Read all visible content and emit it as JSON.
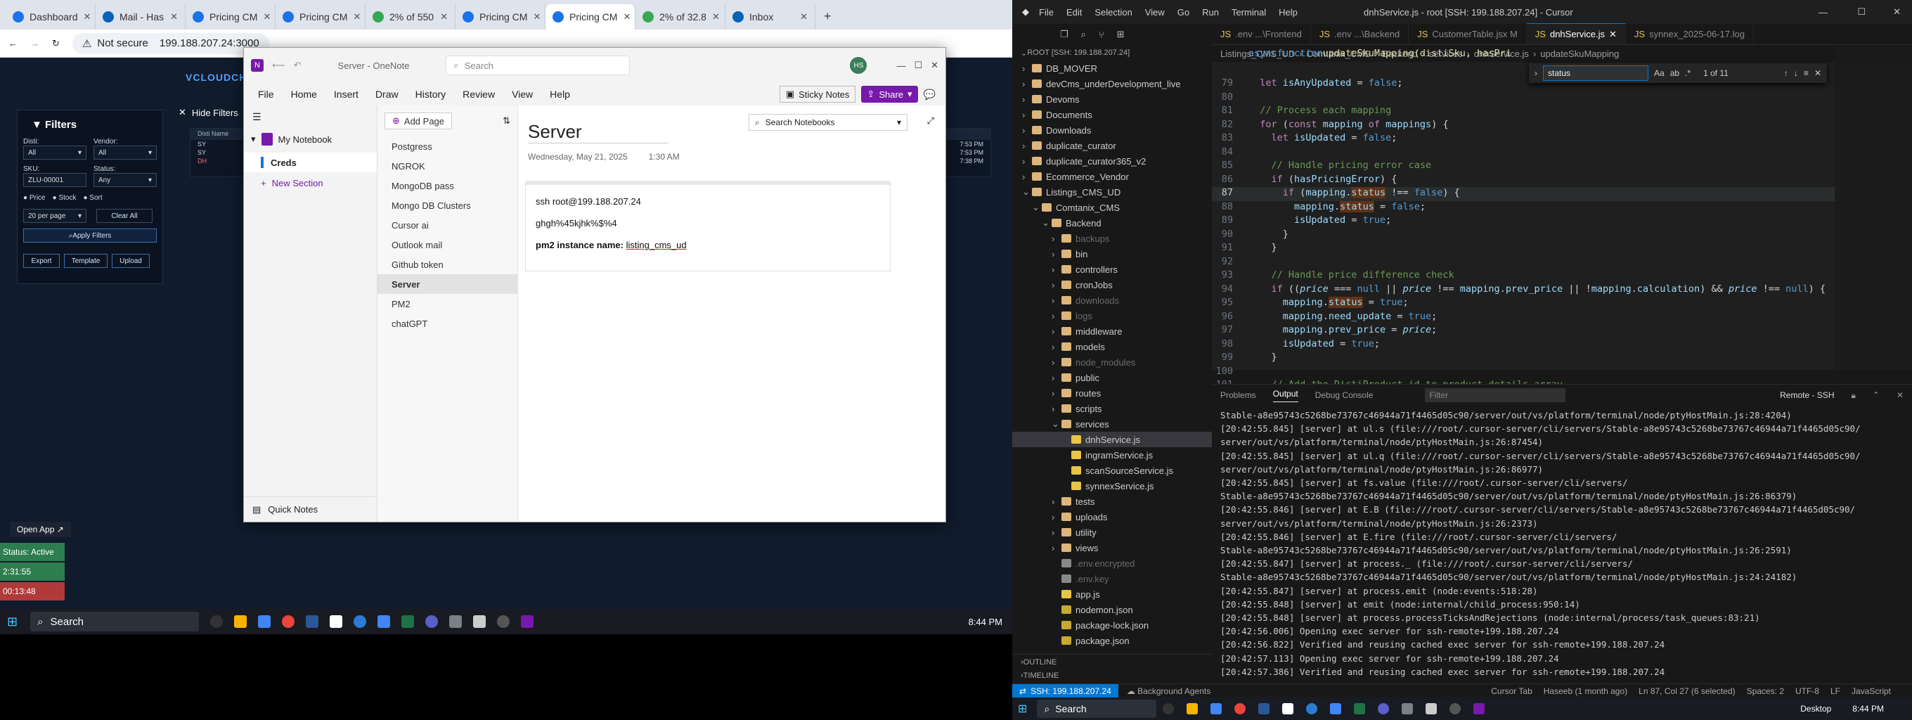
{
  "browser": {
    "tabs": [
      {
        "title": "Dashboard",
        "color": "#1a73e8"
      },
      {
        "title": "Mail - Has",
        "color": "#0364b8"
      },
      {
        "title": "Pricing CM",
        "color": "#1a73e8"
      },
      {
        "title": "Pricing CM",
        "color": "#1a73e8"
      },
      {
        "title": "2% of 550",
        "color": "#34a853"
      },
      {
        "title": "Pricing CM",
        "color": "#1a73e8"
      },
      {
        "title": "Pricing CM",
        "color": "#1a73e8"
      },
      {
        "title": "2% of 32.8",
        "color": "#34a853"
      },
      {
        "title": "Inbox",
        "color": "#0364b8"
      }
    ],
    "security": "Not secure",
    "url": "199.188.207.24:3000"
  },
  "webapp": {
    "brand": "VCLOUDCH",
    "filters_title": "Filters",
    "hide_filters": "Hide Filters",
    "disti_label": "Disti:",
    "disti_value": "All",
    "vendor_label": "Vendor:",
    "vendor_value": "All",
    "sku_label": "SKU:",
    "sku_value": "ZLU-00001",
    "status_label": "Status:",
    "status_value": "Any",
    "radio": [
      "Price",
      "Stock",
      "Sort"
    ],
    "per_page": "20 per page",
    "clear_all": "Clear All",
    "apply": "Apply Filters",
    "export": "Export",
    "template": "Template",
    "upload": "Upload",
    "table_header": "Disti Name",
    "rows": [
      "SY",
      "SY",
      "DH"
    ],
    "times": [
      "7:53 PM",
      "7:53 PM",
      "7:38 PM"
    ],
    "open_app": "Open App ↗",
    "status_active": "Status: Active",
    "time1": "2:31:55",
    "time2": "00:13:48"
  },
  "taskbar_left": {
    "search": "Search",
    "clock": "8:44 PM"
  },
  "onenote": {
    "title": "Server  -  OneNote",
    "search_placeholder": "Search",
    "avatar": "HS",
    "sticky": "Sticky Notes",
    "share": "Share",
    "menu": [
      "File",
      "Home",
      "Insert",
      "Draw",
      "History",
      "Review",
      "View",
      "Help"
    ],
    "notebook": "My Notebook",
    "section": "Creds",
    "new_section": "New Section",
    "quick_notes": "Quick Notes",
    "add_page": "Add Page",
    "search_notebooks": "Search Notebooks",
    "pages": [
      "Postgress",
      "NGROK",
      "MongoDB pass",
      "Mongo DB Clusters",
      "Cursor ai",
      "Outlook mail",
      "Github token",
      "Server",
      "PM2",
      "chatGPT"
    ],
    "selected_page": "Server",
    "page_title": "Server",
    "page_date": "Wednesday, May 21, 2025",
    "page_time": "1:30 AM",
    "note_line1": "ssh root@199.188.207.24",
    "note_line2": "ghgh%45kjhk%$%4",
    "note_label": "pm2 instance name:",
    "note_value": "listing_cms_ud"
  },
  "cursor": {
    "title": "dnhService.js - root [SSH: 199.188.207.24] - Cursor",
    "menu": [
      "File",
      "Edit",
      "Selection",
      "View",
      "Go",
      "Run",
      "Terminal",
      "Help"
    ],
    "explorer_root": "ROOT [SSH: 199.188.207.24]",
    "tree": [
      {
        "name": "DB_MOVER",
        "depth": 0,
        "type": "folder",
        "open": false
      },
      {
        "name": "devCms_underDevelopment_live",
        "depth": 0,
        "type": "folder",
        "open": false
      },
      {
        "name": "Devoms",
        "depth": 0,
        "type": "folder",
        "open": false
      },
      {
        "name": "Documents",
        "depth": 0,
        "type": "folder",
        "open": false
      },
      {
        "name": "Downloads",
        "depth": 0,
        "type": "folder",
        "open": false
      },
      {
        "name": "duplicate_curator",
        "depth": 0,
        "type": "folder",
        "open": false
      },
      {
        "name": "duplicate_curator365_v2",
        "depth": 0,
        "type": "folder",
        "open": false
      },
      {
        "name": "Ecommerce_Vendor",
        "depth": 0,
        "type": "folder",
        "open": false
      },
      {
        "name": "Listings_CMS_UD",
        "depth": 0,
        "type": "folder",
        "open": true
      },
      {
        "name": "Comtanix_CMS",
        "depth": 1,
        "type": "folder",
        "open": true
      },
      {
        "name": "Backend",
        "depth": 2,
        "type": "folder",
        "open": true
      },
      {
        "name": "backups",
        "depth": 3,
        "type": "folder",
        "open": false,
        "dim": true
      },
      {
        "name": "bin",
        "depth": 3,
        "type": "folder",
        "open": false
      },
      {
        "name": "controllers",
        "depth": 3,
        "type": "folder",
        "open": false
      },
      {
        "name": "cronJobs",
        "depth": 3,
        "type": "folder",
        "open": false
      },
      {
        "name": "downloads",
        "depth": 3,
        "type": "folder",
        "open": false,
        "dim": true
      },
      {
        "name": "logs",
        "depth": 3,
        "type": "folder",
        "open": false,
        "dim": true
      },
      {
        "name": "middleware",
        "depth": 3,
        "type": "folder",
        "open": false
      },
      {
        "name": "models",
        "depth": 3,
        "type": "folder",
        "open": false
      },
      {
        "name": "node_modules",
        "depth": 3,
        "type": "folder",
        "open": false,
        "dim": true
      },
      {
        "name": "public",
        "depth": 3,
        "type": "folder",
        "open": false
      },
      {
        "name": "routes",
        "depth": 3,
        "type": "folder",
        "open": false
      },
      {
        "name": "scripts",
        "depth": 3,
        "type": "folder",
        "open": false
      },
      {
        "name": "services",
        "depth": 3,
        "type": "folder",
        "open": true
      },
      {
        "name": "dnhService.js",
        "depth": 4,
        "type": "js",
        "sel": true
      },
      {
        "name": "ingramService.js",
        "depth": 4,
        "type": "js"
      },
      {
        "name": "scanSourceService.js",
        "depth": 4,
        "type": "js"
      },
      {
        "name": "synnexService.js",
        "depth": 4,
        "type": "js"
      },
      {
        "name": "tests",
        "depth": 3,
        "type": "folder",
        "open": false
      },
      {
        "name": "uploads",
        "depth": 3,
        "type": "folder",
        "open": false
      },
      {
        "name": "utility",
        "depth": 3,
        "type": "folder",
        "open": false
      },
      {
        "name": "views",
        "depth": 3,
        "type": "folder",
        "open": false
      },
      {
        "name": ".env.encrypted",
        "depth": 3,
        "type": "file",
        "dim": true
      },
      {
        "name": ".env.key",
        "depth": 3,
        "type": "file",
        "dim": true
      },
      {
        "name": "app.js",
        "depth": 3,
        "type": "js"
      },
      {
        "name": "nodemon.json",
        "depth": 3,
        "type": "json"
      },
      {
        "name": "package-lock.json",
        "depth": 3,
        "type": "json"
      },
      {
        "name": "package.json",
        "depth": 3,
        "type": "json"
      }
    ],
    "outline": "OUTLINE",
    "timeline": "TIMELINE",
    "tabs": [
      {
        "name": ".env ...\\Frontend",
        "active": false
      },
      {
        "name": ".env ...\\Backend",
        "active": false
      },
      {
        "name": "CustomerTable.jsx M",
        "active": false
      },
      {
        "name": "dnhService.js",
        "active": true
      },
      {
        "name": "synnex_2025-06-17.log",
        "active": false
      }
    ],
    "breadcrumb": [
      "Listings_CMS_UD",
      "Comtanix_CMS",
      "Backend",
      "services",
      "dnhService.js",
      "updateSkuMapping"
    ],
    "find_value": "status",
    "find_count": "1 of 11",
    "code_first_line": "async function updateSkuMapping(distiSku, hasPri",
    "code_lines": [
      {
        "n": "79",
        "t": "  let isAnyUpdated = false;"
      },
      {
        "n": "80",
        "t": ""
      },
      {
        "n": "81",
        "t": "  // Process each mapping"
      },
      {
        "n": "82",
        "t": "  for (const mapping of mappings) {"
      },
      {
        "n": "83",
        "t": "    let isUpdated = false;"
      },
      {
        "n": "84",
        "t": ""
      },
      {
        "n": "85",
        "t": "    // Handle pricing error case"
      },
      {
        "n": "86",
        "t": "    if (hasPricingError) {"
      },
      {
        "n": "87",
        "t": "      if (mapping.status !== false) {"
      },
      {
        "n": "88",
        "t": "        mapping.status = false;"
      },
      {
        "n": "89",
        "t": "        isUpdated = true;"
      },
      {
        "n": "90",
        "t": "      }"
      },
      {
        "n": "91",
        "t": "    }"
      },
      {
        "n": "92",
        "t": ""
      },
      {
        "n": "93",
        "t": "    // Handle price difference check"
      },
      {
        "n": "94",
        "t": "    if ((price === null || price !== mapping.prev_price || !mapping.calculation) && price !== null) {"
      },
      {
        "n": "95",
        "t": "      mapping.status = true;"
      },
      {
        "n": "96",
        "t": "      mapping.need_update = true;"
      },
      {
        "n": "97",
        "t": "      mapping.prev_price = price;"
      },
      {
        "n": "98",
        "t": "      isUpdated = true;"
      },
      {
        "n": "99",
        "t": "    }"
      },
      {
        "n": "100",
        "t": ""
      },
      {
        "n": "101",
        "t": "    // Add the DistiProduct id to product details array"
      }
    ],
    "panel_tabs": [
      "Problems",
      "Output",
      "Debug Console"
    ],
    "panel_filter": "Filter",
    "panel_source": "Remote - SSH",
    "output": [
      "Stable-a8e95743c5268be73767c46944a71f4465d05c90/server/out/vs/platform/terminal/node/ptyHostMain.js:28:4204)",
      "[20:42:55.845] [server]     at ul.s (file:///root/.cursor-server/cli/servers/Stable-a8e95743c5268be73767c46944a71f4465d05c90/",
      "server/out/vs/platform/terminal/node/ptyHostMain.js:26:87454)",
      "[20:42:55.845] [server]     at ul.q (file:///root/.cursor-server/cli/servers/Stable-a8e95743c5268be73767c46944a71f4465d05c90/",
      "server/out/vs/platform/terminal/node/ptyHostMain.js:26:86977)",
      "[20:42:55.845] [server]     at fs.value (file:///root/.cursor-server/cli/servers/",
      "Stable-a8e95743c5268be73767c46944a71f4465d05c90/server/out/vs/platform/terminal/node/ptyHostMain.js:26:86379)",
      "[20:42:55.846] [server]     at E.B (file:///root/.cursor-server/cli/servers/Stable-a8e95743c5268be73767c46944a71f4465d05c90/",
      "server/out/vs/platform/terminal/node/ptyHostMain.js:26:2373)",
      "[20:42:55.846] [server]     at E.fire (file:///root/.cursor-server/cli/servers/",
      "Stable-a8e95743c5268be73767c46944a71f4465d05c90/server/out/vs/platform/terminal/node/ptyHostMain.js:26:2591)",
      "[20:42:55.847] [server]     at process._ (file:///root/.cursor-server/cli/servers/",
      "Stable-a8e95743c5268be73767c46944a71f4465d05c90/server/out/vs/platform/terminal/node/ptyHostMain.js:24:24182)",
      "[20:42:55.847] [server]     at process.emit (node:events:518:28)",
      "[20:42:55.848] [server]     at emit (node:internal/child_process:950:14)",
      "[20:42:55.848] [server]     at process.processTicksAndRejections (node:internal/process/task_queues:83:21)",
      "[20:42:56.006] Opening exec server for ssh-remote+199.188.207.24",
      "[20:42:56.822] Verified and reusing cached exec server for ssh-remote+199.188.207.24",
      "[20:42:57.113] Opening exec server for ssh-remote+199.188.207.24",
      "[20:42:57.386] Verified and reusing cached exec server for ssh-remote+199.188.207.24"
    ],
    "status_ssh": "SSH: 199.188.207.24",
    "status_agents": "Background Agents",
    "status_tab": "Cursor Tab",
    "status_blame": "Haseeb (1 month ago)",
    "status_pos": "Ln 87, Col 27 (6 selected)",
    "status_spaces": "Spaces: 2",
    "status_enc": "UTF-8",
    "status_eol": "LF",
    "status_lang": "JavaScript",
    "accent": "#0078d4"
  },
  "taskbar_right": {
    "search": "Search",
    "desktop": "Desktop",
    "clock": "8:44 PM"
  }
}
